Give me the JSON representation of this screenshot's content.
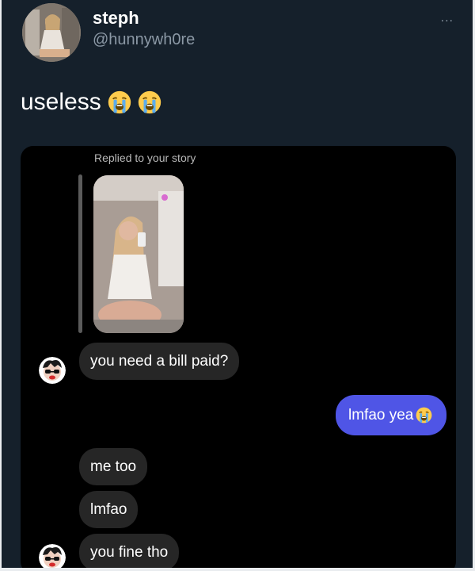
{
  "tweet": {
    "display_name": "steph",
    "handle": "@hunnywh0re",
    "text": "useless",
    "emojis": [
      "loudly-crying-face-emoji",
      "loudly-crying-face-emoji"
    ],
    "more_label": "..."
  },
  "dm": {
    "reply_note": "Replied to your story",
    "messages": [
      {
        "side": "incoming",
        "text": "you need a bill paid?"
      },
      {
        "side": "outgoing",
        "text": "lmfao yea",
        "emoji": "loudly-crying-face-emoji"
      },
      {
        "side": "incoming",
        "text": "me too"
      },
      {
        "side": "incoming",
        "text": "lmfao"
      },
      {
        "side": "incoming",
        "text": "you fine tho"
      }
    ]
  },
  "colors": {
    "background": "#15202b",
    "dm_background": "#000000",
    "incoming_bubble": "#262626",
    "outgoing_bubble": "#4f55e6",
    "handle_text": "#8b98a5"
  }
}
